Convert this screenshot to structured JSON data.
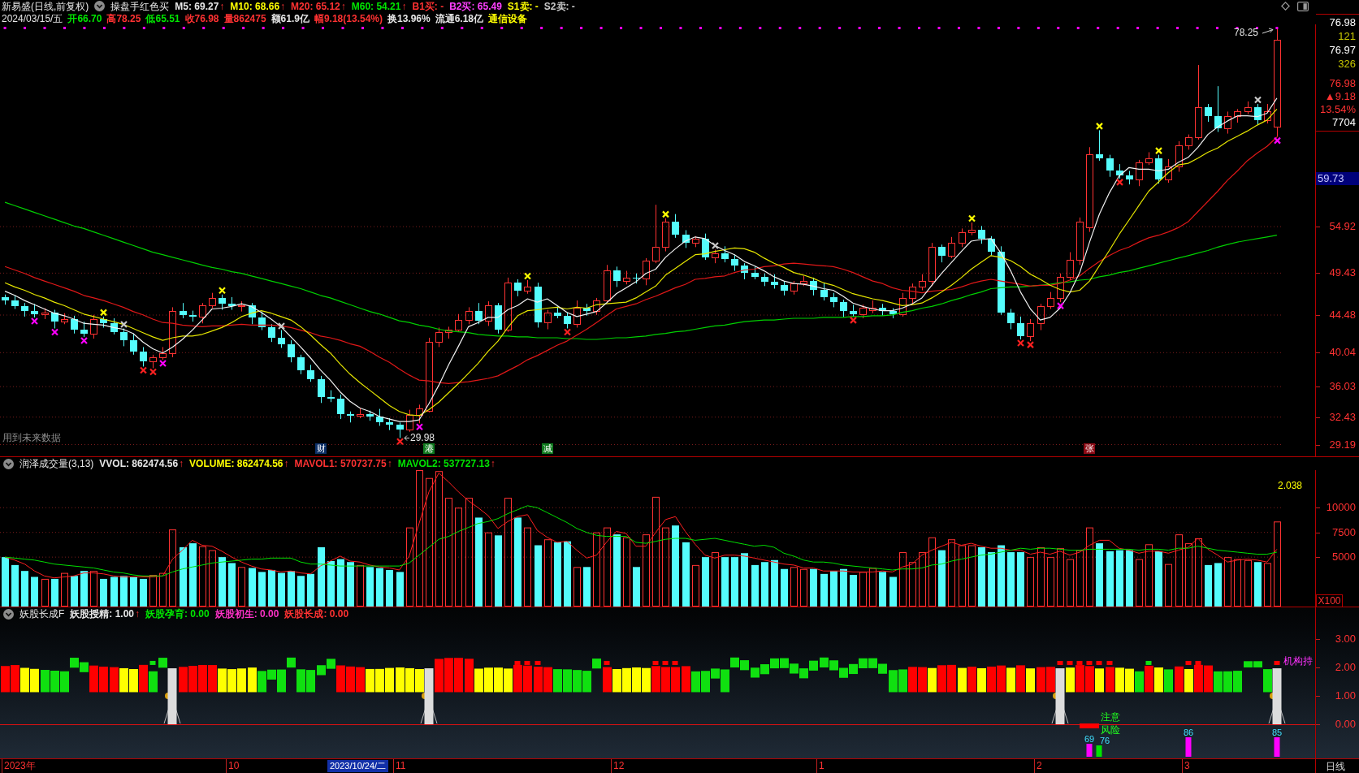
{
  "header": {
    "title": "新易盛(日线,前复权)",
    "indicator": "操盘手红色买",
    "values": [
      {
        "label": "M5: 69.27",
        "arrow": "↑",
        "color": "#e6e6e6"
      },
      {
        "label": "M10: 68.66",
        "arrow": "↑",
        "color": "#ffff00"
      },
      {
        "label": "M20: 65.12",
        "arrow": "↑",
        "color": "#ff3232"
      },
      {
        "label": "M60: 54.21",
        "arrow": "↑",
        "color": "#00e600"
      },
      {
        "label": "B1买: -",
        "color": "#ff3232"
      },
      {
        "label": "B2买: 65.49",
        "color": "#ff40ff"
      },
      {
        "label": "S1卖: -",
        "color": "#ffff00"
      },
      {
        "label": "S2卖: -",
        "color": "#c8c8c8"
      }
    ]
  },
  "quote": {
    "date": "2024/03/15/五",
    "fields": [
      {
        "text": "开66.70",
        "color": "#00e600"
      },
      {
        "text": "高78.25",
        "color": "#ff3232"
      },
      {
        "text": "低65.51",
        "color": "#00e600"
      },
      {
        "text": "收76.98",
        "color": "#ff3232"
      },
      {
        "text": "量862475",
        "color": "#ff3232"
      },
      {
        "text": "额61.9亿",
        "color": "#e6e6e6"
      },
      {
        "text": "幅9.18(13.54%)",
        "color": "#ff3232"
      },
      {
        "text": "换13.96%",
        "color": "#e6e6e6"
      },
      {
        "text": "流通6.18亿",
        "color": "#e6e6e6"
      },
      {
        "text": "通信设备",
        "color": "#ffff00"
      }
    ]
  },
  "price_panel": {
    "note": "用到未来数据",
    "low_label": "29.98",
    "high_label": "78.25",
    "tags": [
      {
        "text": "财",
        "color": "#0c3068"
      },
      {
        "text": "港",
        "color": "#0f7a1e"
      },
      {
        "text": "减",
        "color": "#0f7a1e"
      },
      {
        "text": "张",
        "color": "#8c0a14"
      }
    ],
    "quote_box": [
      {
        "text": "76.98",
        "color": "#ffffff"
      },
      {
        "text": "121",
        "color": "#c8c800"
      },
      {
        "text": "76.97",
        "color": "#ffffff"
      },
      {
        "text": "326",
        "color": "#c8c800"
      },
      {
        "text": "76.98",
        "color": "#ff3232"
      },
      {
        "text": "▲9.18",
        "color": "#ff3232"
      },
      {
        "text": "13.54%",
        "color": "#ff3232"
      },
      {
        "text": "7704",
        "color": "#ffffff"
      }
    ],
    "cursor_price": "59.73",
    "chart_data": {
      "type": "candlestick",
      "ylim": [
        27.8,
        78.8
      ],
      "yticks": [
        54.92,
        49.43,
        44.48,
        40.04,
        36.03,
        32.43,
        29.19
      ],
      "grid": true,
      "ohlc": [
        [
          46.6,
          46.9,
          45.7,
          46.2
        ],
        [
          46.2,
          46.8,
          45.2,
          45.5
        ],
        [
          45.5,
          45.9,
          44.3,
          45.0
        ],
        [
          45.0,
          45.8,
          44.2,
          44.6
        ],
        [
          44.6,
          45.3,
          44.0,
          44.8
        ],
        [
          44.8,
          45.1,
          42.9,
          43.7
        ],
        [
          43.7,
          44.7,
          43.4,
          44.0
        ],
        [
          44.0,
          44.4,
          42.3,
          42.8
        ],
        [
          42.8,
          43.7,
          41.9,
          42.3
        ],
        [
          42.3,
          44.5,
          41.7,
          44.0
        ],
        [
          44.0,
          44.3,
          43.0,
          43.5
        ],
        [
          43.5,
          44.1,
          42.2,
          42.5
        ],
        [
          42.5,
          42.9,
          40.8,
          41.5
        ],
        [
          41.5,
          42.3,
          39.8,
          40.2
        ],
        [
          40.2,
          40.7,
          38.4,
          39.0
        ],
        [
          39.0,
          39.8,
          38.2,
          39.5
        ],
        [
          39.5,
          40.7,
          39.2,
          40.0
        ],
        [
          40.0,
          45.4,
          39.5,
          45.0
        ],
        [
          45.0,
          45.9,
          44.1,
          44.5
        ],
        [
          44.5,
          45.0,
          43.7,
          44.3
        ],
        [
          44.3,
          45.9,
          43.5,
          45.6
        ],
        [
          45.6,
          47.1,
          45.3,
          46.5
        ],
        [
          46.5,
          46.9,
          45.1,
          45.8
        ],
        [
          45.8,
          46.6,
          45.1,
          45.5
        ],
        [
          45.5,
          46.1,
          44.9,
          45.6
        ],
        [
          45.6,
          45.9,
          43.4,
          44.2
        ],
        [
          44.2,
          44.9,
          42.7,
          43.0
        ],
        [
          43.0,
          43.4,
          41.3,
          41.8
        ],
        [
          41.8,
          42.7,
          40.6,
          41.0
        ],
        [
          41.0,
          41.5,
          38.9,
          39.5
        ],
        [
          39.5,
          39.8,
          37.5,
          38.0
        ],
        [
          38.0,
          38.6,
          36.6,
          36.9
        ],
        [
          36.9,
          37.3,
          34.1,
          34.8
        ],
        [
          34.8,
          35.6,
          34.2,
          34.6
        ],
        [
          34.6,
          35.1,
          32.2,
          32.8
        ],
        [
          32.8,
          33.1,
          31.8,
          32.6
        ],
        [
          32.6,
          33.5,
          32.3,
          32.8
        ],
        [
          32.8,
          33.2,
          32.0,
          32.5
        ],
        [
          32.5,
          33.4,
          31.4,
          31.8
        ],
        [
          31.8,
          32.3,
          30.9,
          31.5
        ],
        [
          31.5,
          31.8,
          29.98,
          31.0
        ],
        [
          31.0,
          33.3,
          30.7,
          32.7
        ],
        [
          32.7,
          33.9,
          31.7,
          33.5
        ],
        [
          33.2,
          41.8,
          33.0,
          41.3
        ],
        [
          41.3,
          43.0,
          40.7,
          42.5
        ],
        [
          42.5,
          43.1,
          41.7,
          42.8
        ],
        [
          42.8,
          44.6,
          42.5,
          43.9
        ],
        [
          43.9,
          45.4,
          43.4,
          45.0
        ],
        [
          45.0,
          45.9,
          43.4,
          43.8
        ],
        [
          43.8,
          46.1,
          43.2,
          45.6
        ],
        [
          45.6,
          45.9,
          42.3,
          42.8
        ],
        [
          42.8,
          48.9,
          42.5,
          48.3
        ],
        [
          48.3,
          48.7,
          46.7,
          47.4
        ],
        [
          47.4,
          48.6,
          47.0,
          47.8
        ],
        [
          47.8,
          48.3,
          43.0,
          43.6
        ],
        [
          43.6,
          45.1,
          42.8,
          44.8
        ],
        [
          44.8,
          45.5,
          44.1,
          44.4
        ],
        [
          44.4,
          44.8,
          42.9,
          43.4
        ],
        [
          43.4,
          46.2,
          43.0,
          45.3
        ],
        [
          45.3,
          45.8,
          44.4,
          45.0
        ],
        [
          45.0,
          46.5,
          44.5,
          46.2
        ],
        [
          46.2,
          50.4,
          45.9,
          49.8
        ],
        [
          49.8,
          50.2,
          47.8,
          48.5
        ],
        [
          48.5,
          49.7,
          48.1,
          48.9
        ],
        [
          48.9,
          49.4,
          48.2,
          48.8
        ],
        [
          48.8,
          51.2,
          48.0,
          50.9
        ],
        [
          50.9,
          57.5,
          50.6,
          52.5
        ],
        [
          52.5,
          55.9,
          52.0,
          55.5
        ],
        [
          55.5,
          56.4,
          53.6,
          54.0
        ],
        [
          54.0,
          54.5,
          52.4,
          53.0
        ],
        [
          53.0,
          53.8,
          52.5,
          53.5
        ],
        [
          53.5,
          54.1,
          51.0,
          51.3
        ],
        [
          51.3,
          52.2,
          50.6,
          51.8
        ],
        [
          51.8,
          52.6,
          50.7,
          51.1
        ],
        [
          51.1,
          51.6,
          49.7,
          50.3
        ],
        [
          50.3,
          50.6,
          48.7,
          49.5
        ],
        [
          49.5,
          50.2,
          48.7,
          49.0
        ],
        [
          49.0,
          49.4,
          47.9,
          48.4
        ],
        [
          48.4,
          49.3,
          47.6,
          48.0
        ],
        [
          48.0,
          48.5,
          46.8,
          47.4
        ],
        [
          47.4,
          48.5,
          46.9,
          48.2
        ],
        [
          48.2,
          49.1,
          47.9,
          48.5
        ],
        [
          48.5,
          48.9,
          46.8,
          47.5
        ],
        [
          47.5,
          48.3,
          46.2,
          46.6
        ],
        [
          46.6,
          47.1,
          45.4,
          46.0
        ],
        [
          46.0,
          46.3,
          44.2,
          45.0
        ],
        [
          45.0,
          45.7,
          44.3,
          44.6
        ],
        [
          44.6,
          45.7,
          44.1,
          45.3
        ],
        [
          45.1,
          46.2,
          44.7,
          45.3
        ],
        [
          45.3,
          45.8,
          44.4,
          45.0
        ],
        [
          45.0,
          45.3,
          44.1,
          44.6
        ],
        [
          44.6,
          47.1,
          44.3,
          46.5
        ],
        [
          46.5,
          48.2,
          45.8,
          47.8
        ],
        [
          47.8,
          49.3,
          47.4,
          48.5
        ],
        [
          48.5,
          53.0,
          47.9,
          52.5
        ],
        [
          52.5,
          52.8,
          50.7,
          51.5
        ],
        [
          51.5,
          53.7,
          51.2,
          53.0
        ],
        [
          53.0,
          54.7,
          52.5,
          54.3
        ],
        [
          54.3,
          55.4,
          53.9,
          54.5
        ],
        [
          54.5,
          55.0,
          52.9,
          53.5
        ],
        [
          53.5,
          53.8,
          51.5,
          52.0
        ],
        [
          52.0,
          52.6,
          44.5,
          44.8
        ],
        [
          44.8,
          45.2,
          42.8,
          43.5
        ],
        [
          43.5,
          44.3,
          41.6,
          42.0
        ],
        [
          42.0,
          44.0,
          41.4,
          43.5
        ],
        [
          43.5,
          45.8,
          42.7,
          45.5
        ],
        [
          45.5,
          47.2,
          45.2,
          46.5
        ],
        [
          46.5,
          49.4,
          46.0,
          49.0
        ],
        [
          49.0,
          51.9,
          48.6,
          51.0
        ],
        [
          51.0,
          56.0,
          50.4,
          55.5
        ],
        [
          54.8,
          64.3,
          54.3,
          63.5
        ],
        [
          63.5,
          66.3,
          62.7,
          63.0
        ],
        [
          63.0,
          63.4,
          60.8,
          61.5
        ],
        [
          61.5,
          62.3,
          60.6,
          61.0
        ],
        [
          61.0,
          61.5,
          59.9,
          60.5
        ],
        [
          60.5,
          62.8,
          59.7,
          62.5
        ],
        [
          62.5,
          63.7,
          62.2,
          63.0
        ],
        [
          63.0,
          63.4,
          60.0,
          60.5
        ],
        [
          60.5,
          62.9,
          60.1,
          62.0
        ],
        [
          62.0,
          65.0,
          61.4,
          64.5
        ],
        [
          64.5,
          65.8,
          64.0,
          65.5
        ],
        [
          65.5,
          74.0,
          65.2,
          69.0
        ],
        [
          69.0,
          69.4,
          67.3,
          68.0
        ],
        [
          68.0,
          71.5,
          66.1,
          66.5
        ],
        [
          66.5,
          68.5,
          65.9,
          68.0
        ],
        [
          68.0,
          68.8,
          67.2,
          68.5
        ],
        [
          68.5,
          69.7,
          68.2,
          69.0
        ],
        [
          69.0,
          69.4,
          67.0,
          67.5
        ],
        [
          67.5,
          69.4,
          67.1,
          68.5
        ],
        [
          66.7,
          78.25,
          65.51,
          76.98
        ]
      ],
      "series": [
        {
          "type": "line",
          "color": "#00d000",
          "values": [
            57.8,
            57.4,
            57.0,
            56.6,
            56.2,
            55.8,
            55.4,
            55.0,
            54.7,
            54.3,
            53.9,
            53.5,
            53.1,
            52.7,
            52.3,
            51.9,
            51.6,
            51.3,
            51.0,
            50.7,
            50.4,
            50.1,
            49.9,
            49.6,
            49.4,
            49.1,
            48.8,
            48.5,
            48.2,
            47.9,
            47.6,
            47.2,
            46.8,
            46.5,
            46.1,
            45.7,
            45.3,
            44.9,
            44.6,
            44.2,
            43.8,
            43.6,
            43.3,
            43.1,
            42.8,
            42.6,
            42.5,
            42.4,
            42.2,
            42.1,
            42.0,
            42.0,
            41.9,
            41.9,
            41.8,
            41.8,
            41.8,
            41.7,
            41.7,
            41.6,
            41.6,
            41.7,
            41.8,
            41.8,
            41.9,
            42.0,
            42.2,
            42.3,
            42.5,
            42.6,
            42.8,
            43.0,
            43.2,
            43.3,
            43.5,
            43.7,
            43.8,
            43.9,
            43.9,
            44.0,
            44.1,
            44.1,
            44.1,
            44.2,
            44.2,
            44.2,
            44.3,
            44.3,
            44.4,
            44.4,
            44.5,
            44.8,
            45.0,
            45.3,
            45.5,
            45.8,
            46.2,
            46.5,
            46.9,
            47.2,
            47.6,
            47.7,
            47.8,
            47.8,
            47.9,
            48.0,
            48.1,
            48.3,
            48.4,
            48.6,
            48.7,
            49.0,
            49.2,
            49.5,
            49.7,
            50.0,
            50.3,
            50.6,
            50.9,
            51.2,
            51.5,
            51.8,
            52.1,
            52.5,
            52.8,
            53.1,
            53.3,
            53.5,
            53.7,
            53.9
          ]
        },
        {
          "type": "line",
          "color": "#e01818",
          "values": [
            50.2,
            49.8,
            49.4,
            48.9,
            48.5,
            48.1,
            47.7,
            47.3,
            46.8,
            46.5,
            46.2,
            45.8,
            45.4,
            44.9,
            44.5,
            44.0,
            43.6,
            43.5,
            43.3,
            43.2,
            43.1,
            43.2,
            43.2,
            43.3,
            43.4,
            43.3,
            43.3,
            43.3,
            43.2,
            43.0,
            42.7,
            42.4,
            42.0,
            41.8,
            41.5,
            41.1,
            40.8,
            40.2,
            39.5,
            38.9,
            38.1,
            37.4,
            36.8,
            36.7,
            36.5,
            36.4,
            36.5,
            36.6,
            36.8,
            37.0,
            37.3,
            37.9,
            38.5,
            39.2,
            39.7,
            40.3,
            40.9,
            41.4,
            42.1,
            42.8,
            43.6,
            44.4,
            45.2,
            45.5,
            45.8,
            46.3,
            46.7,
            47.2,
            47.7,
            48.1,
            48.7,
            48.8,
            49.0,
            49.1,
            49.5,
            49.8,
            49.9,
            50.2,
            50.3,
            50.5,
            50.6,
            50.5,
            50.4,
            50.3,
            50.2,
            49.9,
            49.5,
            49.0,
            48.5,
            48.2,
            47.7,
            47.4,
            47.3,
            47.1,
            47.3,
            47.4,
            47.5,
            47.8,
            48.2,
            48.5,
            48.7,
            48.5,
            48.3,
            48.1,
            47.9,
            48.0,
            48.0,
            48.2,
            48.6,
            49.1,
            50.0,
            50.8,
            51.5,
            52.1,
            52.5,
            53.1,
            53.6,
            53.9,
            54.3,
            54.8,
            55.5,
            56.7,
            57.9,
            59.1,
            60.4,
            61.5,
            62.7,
            63.6,
            64.4,
            65.5
          ]
        },
        {
          "type": "line",
          "color": "#e6e600",
          "values": [
            48.3,
            47.8,
            47.4,
            46.9,
            46.5,
            46.0,
            45.6,
            45.1,
            44.6,
            44.3,
            44.0,
            43.7,
            43.4,
            42.9,
            42.4,
            41.9,
            41.5,
            41.8,
            42.0,
            42.0,
            42.2,
            42.6,
            43.0,
            43.6,
            44.3,
            44.7,
            45.0,
            44.7,
            44.3,
            43.9,
            43.1,
            42.1,
            41.0,
            40.0,
            38.7,
            37.5,
            36.5,
            35.6,
            34.7,
            33.8,
            33.1,
            32.7,
            32.6,
            33.3,
            34.2,
            35.3,
            36.4,
            37.6,
            38.8,
            40.2,
            41.4,
            43.0,
            44.4,
            45.0,
            45.1,
            45.3,
            45.4,
            45.2,
            45.4,
            45.3,
            45.7,
            45.8,
            45.9,
            46.0,
            46.5,
            47.2,
            47.9,
            49.2,
            50.0,
            50.8,
            51.6,
            51.7,
            52.0,
            52.2,
            52.4,
            52.3,
            51.9,
            51.2,
            50.6,
            50.1,
            49.5,
            49.2,
            48.8,
            48.3,
            48.0,
            47.5,
            47.0,
            46.7,
            46.4,
            46.2,
            45.9,
            45.6,
            45.7,
            45.9,
            46.5,
            47.2,
            48.0,
            48.9,
            49.9,
            50.7,
            51.5,
            51.3,
            50.9,
            50.2,
            49.3,
            48.7,
            48.0,
            47.5,
            47.2,
            47.4,
            48.5,
            50.3,
            52.1,
            54.0,
            55.7,
            57.4,
            59.1,
            60.2,
            61.3,
            62.2,
            62.4,
            63.0,
            63.7,
            64.2,
            65.0,
            65.6,
            66.2,
            66.9,
            67.5,
            68.8
          ]
        },
        {
          "type": "line",
          "color": "#f0f0f0",
          "values": [
            47.3,
            46.8,
            46.2,
            45.7,
            45.2,
            44.7,
            44.4,
            44.0,
            43.5,
            43.4,
            43.3,
            43.0,
            42.8,
            42.3,
            41.3,
            40.5,
            40.0,
            40.7,
            41.6,
            42.7,
            43.9,
            45.2,
            45.3,
            45.5,
            45.8,
            45.5,
            44.8,
            44.0,
            43.1,
            41.9,
            40.7,
            39.4,
            38.0,
            36.8,
            35.4,
            34.3,
            33.5,
            33.1,
            32.5,
            32.2,
            31.9,
            31.9,
            32.1,
            34.0,
            36.2,
            38.6,
            40.8,
            43.1,
            43.6,
            44.2,
            44.2,
            45.1,
            45.6,
            46.4,
            46.0,
            46.4,
            45.6,
            44.8,
            44.3,
            44.6,
            44.9,
            45.9,
            47.0,
            47.7,
            48.4,
            49.4,
            49.9,
            51.3,
            52.3,
            53.2,
            53.7,
            53.5,
            52.7,
            52.1,
            51.6,
            50.8,
            50.3,
            49.7,
            49.0,
            48.5,
            48.2,
            48.1,
            47.9,
            47.6,
            47.4,
            46.7,
            45.9,
            45.5,
            45.2,
            45.0,
            45.0,
            45.3,
            45.8,
            46.5,
            48.0,
            49.4,
            50.7,
            52.0,
            53.2,
            53.4,
            53.5,
            51.8,
            49.7,
            47.2,
            45.2,
            43.9,
            44.2,
            45.3,
            47.1,
            49.5,
            53.1,
            56.4,
            58.9,
            60.9,
            61.9,
            61.7,
            61.7,
            61.5,
            61.7,
            62.5,
            63.1,
            64.3,
            65.8,
            66.7,
            67.4,
            68.0,
            68.0,
            67.9,
            68.3,
            70.1
          ]
        }
      ]
    }
  },
  "volume_panel": {
    "title": "润泽成交量(3,13)",
    "values": [
      {
        "label": "VVOL: 862474.56",
        "arrow": "↑",
        "color": "#e6e6e6"
      },
      {
        "label": "VOLUME: 862474.56",
        "arrow": "↑",
        "color": "#ffff00"
      },
      {
        "label": "MAVOL1: 570737.75",
        "arrow": "↑",
        "color": "#ff3232"
      },
      {
        "label": "MAVOL2: 537727.13",
        "arrow": "↑",
        "color": "#00e600"
      }
    ],
    "value_label": "2.038",
    "unit": "X100",
    "chart_data": {
      "type": "bar",
      "ylim": [
        0,
        13800
      ],
      "yticks": [
        5000,
        7500,
        10000
      ],
      "grid": true,
      "series": [
        {
          "type": "bar",
          "values": [
            5000,
            4200,
            3600,
            3000,
            2800,
            2800,
            3400,
            3100,
            3600,
            3600,
            2800,
            3000,
            3100,
            3000,
            2800,
            3200,
            3400,
            7800,
            6000,
            6400,
            6100,
            5700,
            5000,
            4400,
            4000,
            3900,
            3500,
            3700,
            3400,
            3600,
            3100,
            3300,
            6000,
            4600,
            4800,
            4500,
            4200,
            4000,
            3900,
            3700,
            3500,
            8000,
            13800,
            13000,
            13700,
            11000,
            10000,
            11000,
            9000,
            7500,
            7200,
            11000,
            9000,
            8000,
            6200,
            6800,
            6500,
            6600,
            4000,
            4000,
            7500,
            8000,
            7300,
            7000,
            4000,
            7300,
            11100,
            8000,
            8200,
            6500,
            4200,
            5000,
            5500,
            5000,
            5000,
            5400,
            4200,
            4500,
            4700,
            3800,
            4000,
            3800,
            3800,
            3300,
            3600,
            3800,
            3200,
            3500,
            3900,
            3500,
            3000,
            5500,
            4500,
            5500,
            7000,
            5700,
            6800,
            6200,
            6200,
            6000,
            5500,
            6200,
            5500,
            5500,
            5000,
            6000,
            5000,
            5900,
            4800,
            5700,
            8000,
            6400,
            5600,
            5700,
            5700,
            4800,
            6300,
            5600,
            4300,
            7300,
            6400,
            6900,
            4200,
            4400,
            5000,
            4800,
            4700,
            4500,
            4400,
            8600
          ],
          "colors": [
            "#54fcfc",
            "#54fcfc",
            "#54fcfc",
            "#54fcfc",
            "#ff3232",
            "#54fcfc",
            "#ff3232",
            "#54fcfc",
            "#54fcfc",
            "#ff3232",
            "#54fcfc",
            "#54fcfc",
            "#54fcfc",
            "#54fcfc",
            "#54fcfc",
            "#ff3232",
            "#ff3232",
            "#ff3232",
            "#54fcfc",
            "#54fcfc",
            "#ff3232",
            "#ff3232",
            "#54fcfc",
            "#54fcfc",
            "#ff3232",
            "#54fcfc",
            "#54fcfc",
            "#54fcfc",
            "#54fcfc",
            "#54fcfc",
            "#54fcfc",
            "#54fcfc",
            "#54fcfc",
            "#54fcfc",
            "#54fcfc",
            "#54fcfc",
            "#ff3232",
            "#54fcfc",
            "#54fcfc",
            "#54fcfc",
            "#54fcfc",
            "#ff3232",
            "#ff3232",
            "#ff3232",
            "#ff3232",
            "#ff3232",
            "#ff3232",
            "#ff3232",
            "#54fcfc",
            "#ff3232",
            "#54fcfc",
            "#ff3232",
            "#54fcfc",
            "#ff3232",
            "#54fcfc",
            "#ff3232",
            "#54fcfc",
            "#54fcfc",
            "#ff3232",
            "#54fcfc",
            "#ff3232",
            "#ff3232",
            "#54fcfc",
            "#ff3232",
            "#54fcfc",
            "#ff3232",
            "#ff3232",
            "#ff3232",
            "#54fcfc",
            "#54fcfc",
            "#ff3232",
            "#54fcfc",
            "#ff3232",
            "#54fcfc",
            "#54fcfc",
            "#54fcfc",
            "#54fcfc",
            "#54fcfc",
            "#54fcfc",
            "#54fcfc",
            "#ff3232",
            "#ff3232",
            "#54fcfc",
            "#54fcfc",
            "#54fcfc",
            "#54fcfc",
            "#54fcfc",
            "#ff3232",
            "#ff3232",
            "#54fcfc",
            "#54fcfc",
            "#ff3232",
            "#ff3232",
            "#ff3232",
            "#ff3232",
            "#54fcfc",
            "#ff3232",
            "#ff3232",
            "#ff3232",
            "#54fcfc",
            "#54fcfc",
            "#54fcfc",
            "#54fcfc",
            "#54fcfc",
            "#ff3232",
            "#ff3232",
            "#ff3232",
            "#ff3232",
            "#ff3232",
            "#ff3232",
            "#ff3232",
            "#54fcfc",
            "#54fcfc",
            "#54fcfc",
            "#54fcfc",
            "#ff3232",
            "#ff3232",
            "#54fcfc",
            "#ff3232",
            "#ff3232",
            "#ff3232",
            "#ff3232",
            "#54fcfc",
            "#54fcfc",
            "#ff3232",
            "#ff3232",
            "#ff3232",
            "#54fcfc",
            "#ff3232",
            "#ff3232"
          ]
        },
        {
          "type": "line",
          "color": "#ff2020",
          "values": [
            5000,
            4700,
            4300,
            3600,
            3100,
            2900,
            3000,
            3100,
            3400,
            3400,
            3300,
            3100,
            3000,
            3000,
            3000,
            3000,
            3100,
            4800,
            5700,
            6700,
            6200,
            6100,
            5600,
            5000,
            4500,
            4100,
            3800,
            3700,
            3500,
            3600,
            3400,
            3300,
            4100,
            4600,
            5100,
            4600,
            4500,
            4200,
            4000,
            3900,
            3700,
            5100,
            8400,
            11600,
            13500,
            12600,
            11600,
            10700,
            10000,
            9200,
            7900,
            8600,
            9100,
            9300,
            7700,
            7000,
            6500,
            6600,
            5700,
            4900,
            5200,
            6500,
            7600,
            7400,
            6100,
            6100,
            7500,
            8800,
            9100,
            7600,
            6300,
            5200,
            4900,
            5200,
            5200,
            5100,
            4900,
            4700,
            4500,
            4300,
            4200,
            3900,
            3900,
            3600,
            3600,
            3600,
            3500,
            3500,
            3500,
            3600,
            3500,
            4000,
            4300,
            5200,
            5700,
            6100,
            6500,
            6200,
            6400,
            6100,
            5900,
            5900,
            5700,
            5700,
            5300,
            5500,
            5300,
            5600,
            5200,
            5500,
            6200,
            6700,
            6700,
            5900,
            5700,
            5400,
            5600,
            5600,
            5400,
            5700,
            6000,
            6900,
            5800,
            5200,
            4500,
            4700,
            4800,
            4700,
            4500,
            5800
          ]
        },
        {
          "type": "line",
          "color": "#00e000",
          "values": [
            5000,
            4900,
            4800,
            4700,
            4500,
            4300,
            4200,
            4100,
            4000,
            3900,
            3700,
            3500,
            3400,
            3200,
            3100,
            3100,
            3100,
            3500,
            3800,
            4000,
            4200,
            4400,
            4500,
            4600,
            4700,
            4800,
            4800,
            4900,
            4900,
            4900,
            4500,
            4300,
            4300,
            4200,
            4100,
            4100,
            4100,
            4100,
            4100,
            4100,
            4100,
            4400,
            5200,
            6000,
            6800,
            7100,
            7600,
            8000,
            8400,
            8600,
            8900,
            9400,
            9800,
            10200,
            10000,
            9500,
            9000,
            8500,
            7900,
            7500,
            7200,
            7100,
            7100,
            7100,
            6500,
            6400,
            6600,
            6800,
            6900,
            6900,
            6700,
            6800,
            6900,
            6700,
            6500,
            6300,
            6100,
            6200,
            6000,
            5400,
            5100,
            4700,
            4500,
            4500,
            4400,
            4200,
            4100,
            4000,
            3900,
            3800,
            3700,
            3800,
            3800,
            3900,
            4200,
            4300,
            4600,
            4800,
            5000,
            5200,
            5300,
            5500,
            5700,
            5900,
            5800,
            5900,
            5900,
            5800,
            5700,
            5700,
            5800,
            5800,
            5800,
            5800,
            5800,
            5700,
            5800,
            5800,
            5700,
            5900,
            5900,
            6100,
            5900,
            5700,
            5600,
            5500,
            5400,
            5300,
            5300,
            5500
          ]
        }
      ]
    }
  },
  "indicator_panel": {
    "title": "妖股长成F",
    "values": [
      {
        "label": "妖股授精: 1.00",
        "arrow": "↑",
        "color": "#e6e6e6"
      },
      {
        "label": "妖股孕育: 0.00",
        "color": "#00e600"
      },
      {
        "label": "妖股初生: 0.00",
        "color": "#ff32c8"
      },
      {
        "label": "妖股长成: 0.00",
        "color": "#ff3232"
      }
    ],
    "side_label": "机构持",
    "notes": [
      "注意",
      "风险"
    ],
    "counts": [
      {
        "text": "69",
        "color": "#ff00ff"
      },
      {
        "text": "76",
        "color": "#00e600"
      },
      {
        "text": "86",
        "color": "#ff00ff"
      },
      {
        "text": "85",
        "color": "#ff00ff"
      }
    ],
    "axis_labels": [
      "3.00",
      "2.00",
      "1.00",
      "0.00"
    ]
  },
  "date_axis": {
    "labels": [
      "2023年",
      "10",
      "11",
      "12",
      "1",
      "2",
      "3"
    ],
    "cursor_date": "2023/10/24/二",
    "period": "日线"
  }
}
